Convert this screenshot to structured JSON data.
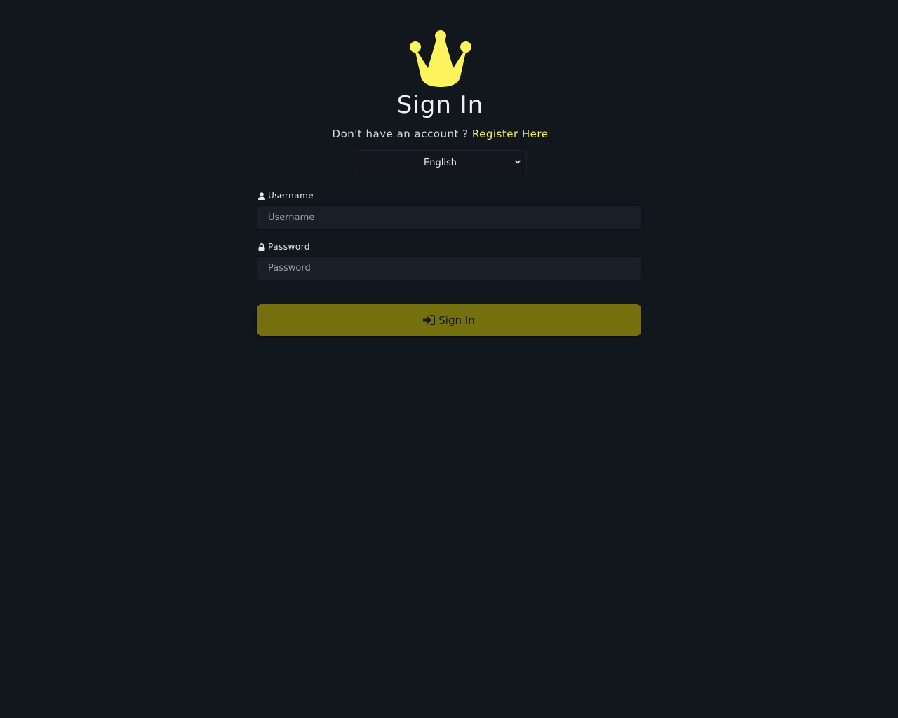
{
  "header": {
    "logo_icon": "crown-icon",
    "title": "Sign In",
    "register_prompt": "Don't have an account ?",
    "register_link": "Register Here"
  },
  "language": {
    "selected": "English",
    "icon": "chevron-down-icon"
  },
  "form": {
    "username_label": "Username",
    "username_icon": "user-icon",
    "username_placeholder": "Username",
    "username_value": "",
    "password_label": "Password",
    "password_icon": "lock-icon",
    "password_placeholder": "Password",
    "password_value": "",
    "submit_label": "Sign In",
    "submit_icon": "sign-in-icon"
  },
  "colors": {
    "background": "#12161d",
    "accent": "#f2ee5a",
    "button": "#74700d"
  }
}
